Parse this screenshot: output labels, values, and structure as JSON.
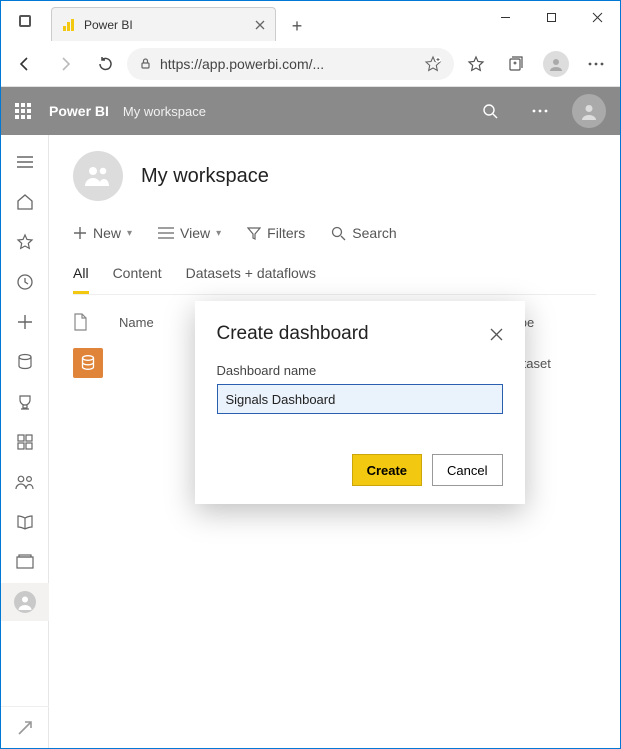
{
  "window": {
    "tab_title": "Power BI",
    "url_display": "https://app.powerbi.com/..."
  },
  "header": {
    "brand": "Power BI",
    "breadcrumb": "My workspace"
  },
  "workspace": {
    "title": "My workspace"
  },
  "toolbar": {
    "new_label": "New",
    "view_label": "View",
    "filters_label": "Filters",
    "search_label": "Search"
  },
  "tabs": {
    "all": "All",
    "content": "Content",
    "datasets": "Datasets + dataflows"
  },
  "columns": {
    "name": "Name",
    "type": "Type"
  },
  "rows": [
    {
      "type": "Dataset"
    }
  ],
  "dialog": {
    "title": "Create dashboard",
    "field_label": "Dashboard name",
    "field_value": "Signals Dashboard",
    "create_label": "Create",
    "cancel_label": "Cancel"
  }
}
